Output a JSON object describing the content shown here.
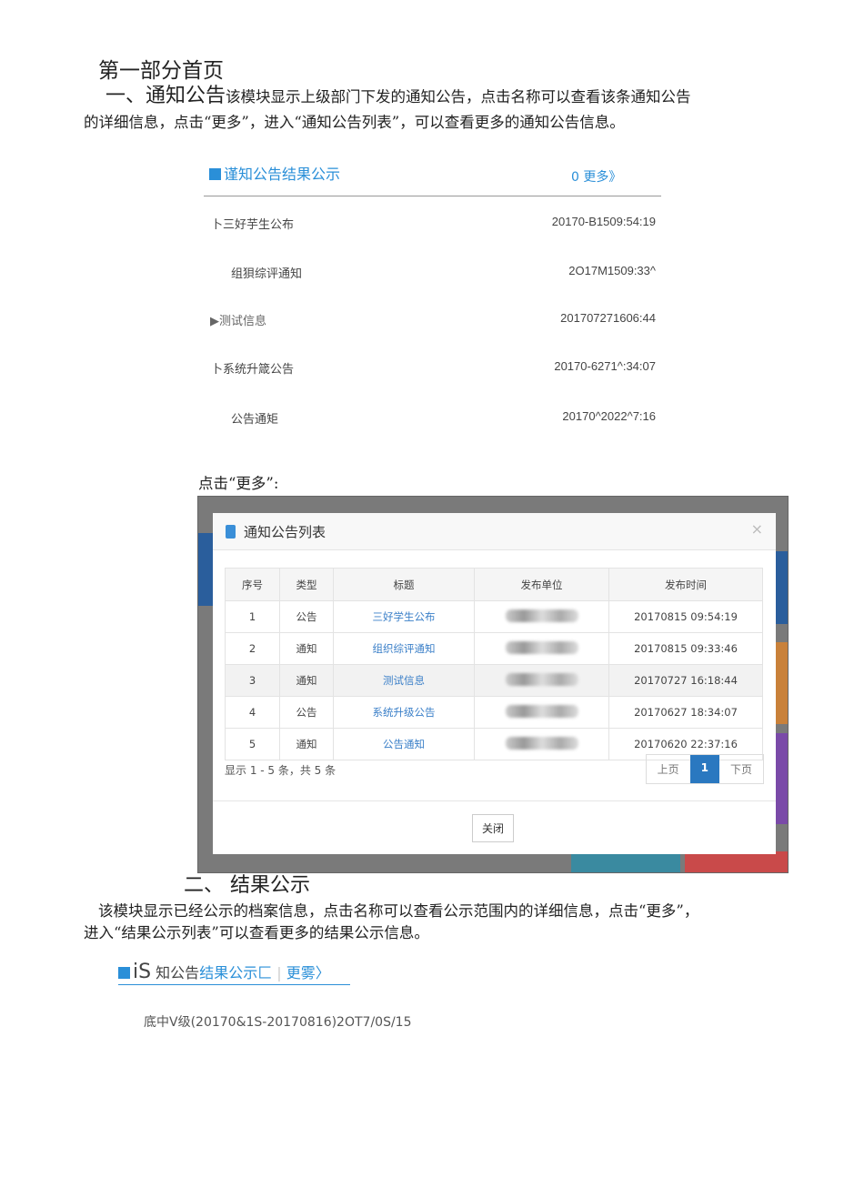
{
  "doc": {
    "part_title": "第一部分首页",
    "s1_heading": "一、通知公告",
    "s1_text_a": "该模块显示上级部门下发的通知公告，点击名称可以查看该条通知公告",
    "s1_text_b": "的详细信息，点击“更多”，进入“通知公告列表”，可以查看更多的通知公告信息。",
    "click_more": "点击“更多”:",
    "s2_heading": "二、    结果公示",
    "s2_text_a": "该模块显示已经公示的档案信息，点击名称可以查看公示范围内的详细信息，点击“更多”，",
    "s2_text_b": "进入“结果公示列表”可以查看更多的结果公示信息。"
  },
  "widget1": {
    "title": "谨知公告结果公示",
    "more": "0 更多》",
    "items": [
      {
        "title": "卜三好芋生公布",
        "time": "20170-B1509:54:19"
      },
      {
        "title": "组狽综评通知",
        "time": "2O17M1509:33^"
      },
      {
        "title": "▶测试信息",
        "time": "201707271606:44"
      },
      {
        "title": "卜系统升箴公告",
        "time": "20170-6271^:34:07"
      },
      {
        "title": "公告通矩",
        "time": "20170^2022^7:16"
      }
    ]
  },
  "modal": {
    "title": "通知公告列表",
    "close_x": "×",
    "headers": [
      "序号",
      "类型",
      "标题",
      "发布单位",
      "发布时间"
    ],
    "rows": [
      {
        "no": "1",
        "type": "公告",
        "title": "三好学生公布",
        "time": "20170815 09:54:19"
      },
      {
        "no": "2",
        "type": "通知",
        "title": "组织综评通知",
        "time": "20170815 09:33:46"
      },
      {
        "no": "3",
        "type": "通知",
        "title": "测试信息",
        "time": "20170727 16:18:44"
      },
      {
        "no": "4",
        "type": "公告",
        "title": "系统升级公告",
        "time": "20170627 18:34:07"
      },
      {
        "no": "5",
        "type": "通知",
        "title": "公告通知",
        "time": "20170620 22:37:16"
      }
    ],
    "summary": "显示 1 - 5 条，共 5 条",
    "prev": "上页",
    "page": "1",
    "next": "下页",
    "close": "关闭"
  },
  "widget2": {
    "prefix": "iS",
    "title_a": "知公告",
    "title_b": "结果公示匚",
    "more": "更雾〉",
    "line": "底中Ⅴ级(20170&1S-20170816)2OT7/0S/15"
  }
}
